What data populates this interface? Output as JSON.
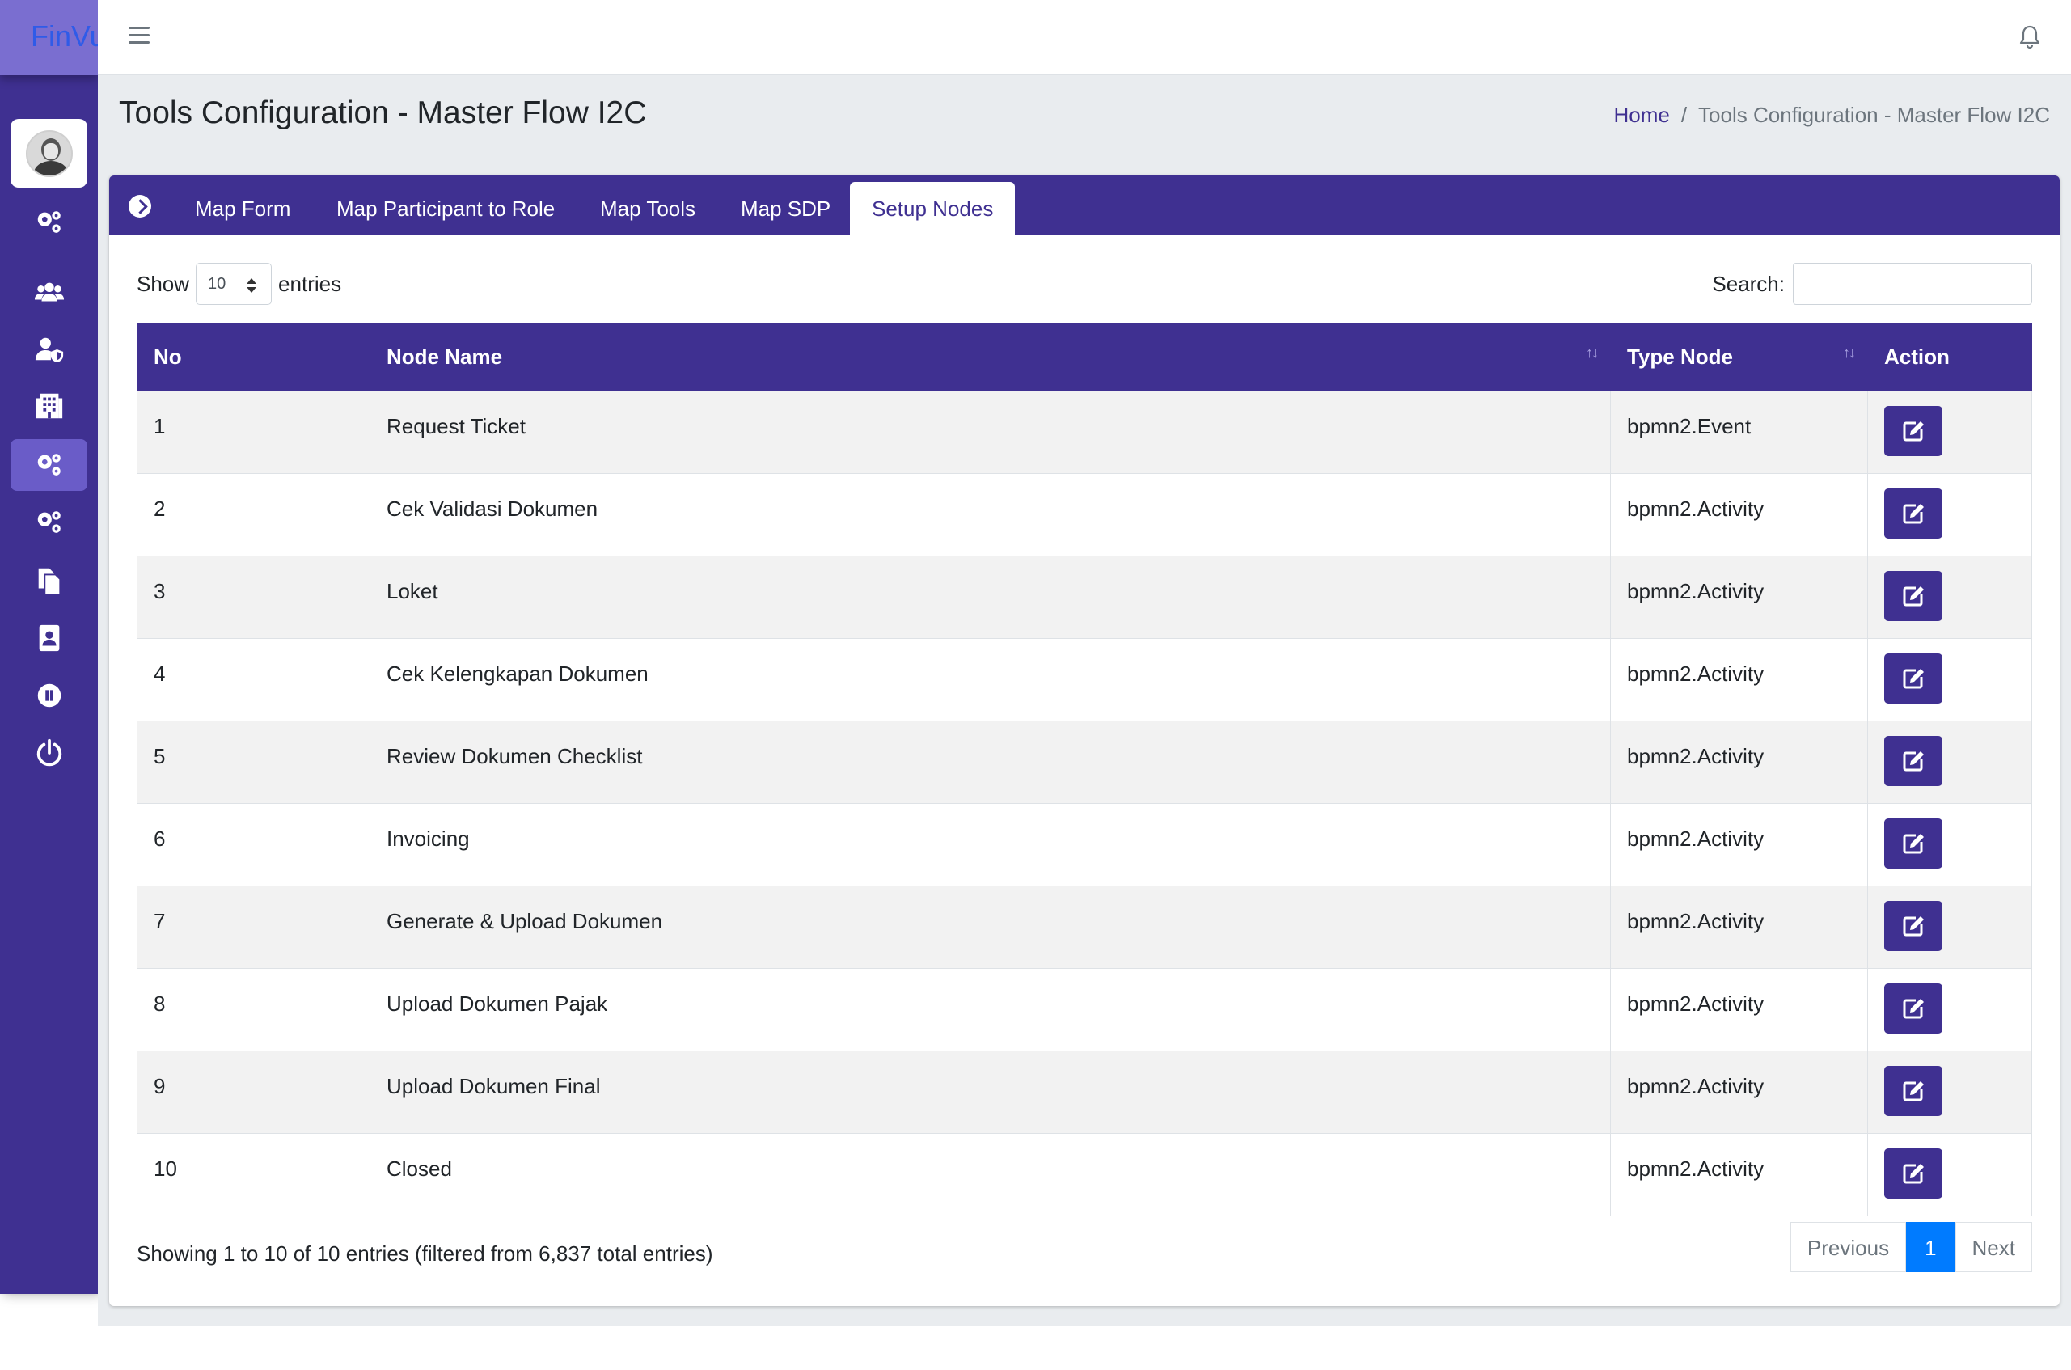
{
  "brand": {
    "name": "FinVu"
  },
  "page": {
    "title": "Tools Configuration - Master Flow I2C"
  },
  "breadcrumb": {
    "home": "Home",
    "separator": "/",
    "current": "Tools Configuration - Master Flow I2C"
  },
  "sidebar": {
    "items": [
      {
        "icon": "gears-icon",
        "active": false
      },
      {
        "icon": "users-icon",
        "active": false
      },
      {
        "icon": "user-shield-icon",
        "active": false
      },
      {
        "icon": "building-icon",
        "active": false
      },
      {
        "icon": "gears-icon",
        "active": true
      },
      {
        "icon": "gears-icon",
        "active": false
      },
      {
        "icon": "copy-icon",
        "active": false
      },
      {
        "icon": "address-book-icon",
        "active": false
      },
      {
        "icon": "pause-circle-icon",
        "active": false
      },
      {
        "icon": "power-icon",
        "active": false
      }
    ]
  },
  "tabs": [
    {
      "label": "Map Form",
      "active": false
    },
    {
      "label": "Map Participant to Role",
      "active": false
    },
    {
      "label": "Map Tools",
      "active": false
    },
    {
      "label": "Map SDP",
      "active": false
    },
    {
      "label": "Setup Nodes",
      "active": true
    }
  ],
  "length_menu": {
    "show_label": "Show",
    "value": "10",
    "entries_label": "entries"
  },
  "search": {
    "label": "Search:",
    "value": ""
  },
  "table": {
    "headers": [
      "No",
      "Node Name",
      "Type Node",
      "Action"
    ],
    "rows": [
      {
        "no": "1",
        "name": "Request Ticket",
        "type": "bpmn2.Event"
      },
      {
        "no": "2",
        "name": "Cek Validasi Dokumen",
        "type": "bpmn2.Activity"
      },
      {
        "no": "3",
        "name": "Loket",
        "type": "bpmn2.Activity"
      },
      {
        "no": "4",
        "name": "Cek Kelengkapan Dokumen",
        "type": "bpmn2.Activity"
      },
      {
        "no": "5",
        "name": "Review Dokumen Checklist",
        "type": "bpmn2.Activity"
      },
      {
        "no": "6",
        "name": "Invoicing",
        "type": "bpmn2.Activity"
      },
      {
        "no": "7",
        "name": "Generate & Upload Dokumen",
        "type": "bpmn2.Activity"
      },
      {
        "no": "8",
        "name": "Upload Dokumen Pajak",
        "type": "bpmn2.Activity"
      },
      {
        "no": "9",
        "name": "Upload Dokumen Final",
        "type": "bpmn2.Activity"
      },
      {
        "no": "10",
        "name": "Closed",
        "type": "bpmn2.Activity"
      }
    ]
  },
  "info": "Showing 1 to 10 of 10 entries (filtered from 6,837 total entries)",
  "pagination": {
    "previous": "Previous",
    "current": "1",
    "next": "Next"
  },
  "colors": {
    "primary": "#3f3091",
    "sidebar_active": "#6a5cc8",
    "page_current": "#007bff",
    "background": "#e9ecef"
  }
}
